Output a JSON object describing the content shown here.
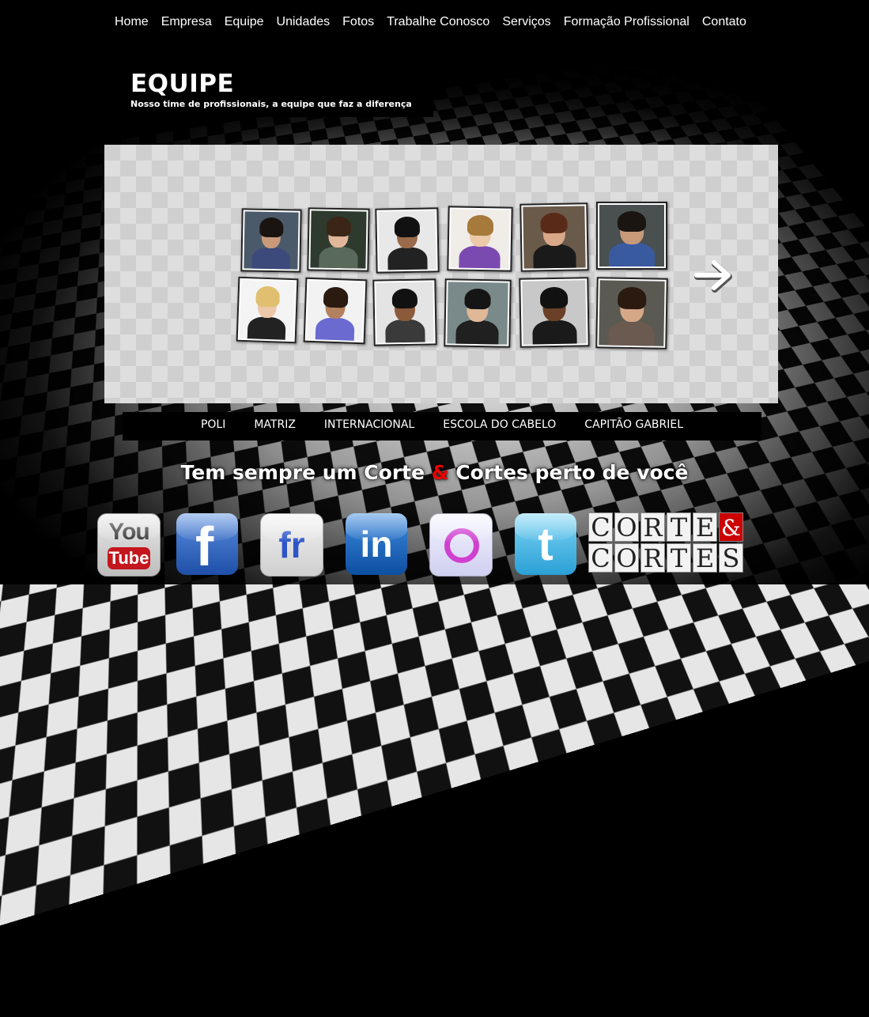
{
  "nav": {
    "items": [
      "Home",
      "Empresa",
      "Equipe",
      "Unidades",
      "Fotos",
      "Trabalhe Conosco",
      "Serviços",
      "Formação Profissional",
      "Contato"
    ]
  },
  "header": {
    "title": "EQUIPE",
    "subtitle": "Nosso time de profissionais, a equipe que faz a diferença"
  },
  "units": {
    "items": [
      "POLI",
      "MATRIZ",
      "INTERNACIONAL",
      "ESCOLA DO CABELO",
      "CAPITÃO GABRIEL"
    ]
  },
  "slogan": {
    "before": "Tem sempre um Corte ",
    "amp": "&",
    "after": " Cortes perto de você"
  },
  "social": {
    "youtube_top": "You",
    "youtube_bottom": "Tube",
    "facebook": "f",
    "friendfeed": "fr",
    "linkedin": "in",
    "twitter": "t"
  },
  "logo": {
    "row1": [
      "C",
      "O",
      "R",
      "T",
      "E",
      "&"
    ],
    "row2": [
      "C",
      "O",
      "R",
      "T",
      "E",
      "S"
    ]
  },
  "colors": {
    "amp_red": "#e00000",
    "logo_red": "#cc0000"
  }
}
